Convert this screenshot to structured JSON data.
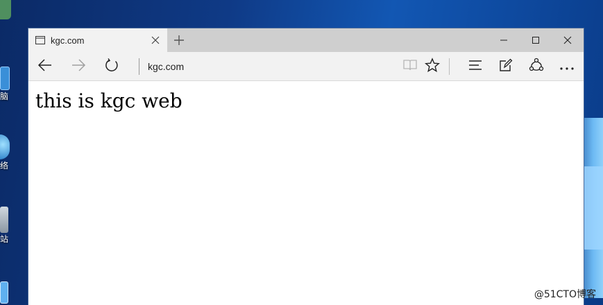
{
  "desktop": {
    "icons": [
      {
        "label": "",
        "name": "desktop-user-icon"
      },
      {
        "label": "脑",
        "name": "desktop-computer-icon"
      },
      {
        "label": "络",
        "name": "desktop-network-icon"
      },
      {
        "label": "站",
        "name": "desktop-recycle-bin-icon"
      },
      {
        "label": "",
        "name": "desktop-control-panel-icon"
      }
    ],
    "watermark": "@51CTO博客"
  },
  "browser": {
    "tab": {
      "title": "kgc.com"
    },
    "address": {
      "value": "kgc.com"
    },
    "icons": {
      "back": "back-arrow-icon",
      "forward": "forward-arrow-icon",
      "refresh": "refresh-icon",
      "reading_view": "reading-view-icon",
      "favorite": "star-icon",
      "hub": "hub-icon",
      "web_note": "web-note-icon",
      "share": "share-icon",
      "more": "more-icon"
    },
    "colors": {
      "tabstrip": "#cfcfcf",
      "toolbar": "#f2f2f2",
      "forward_disabled": "#a0a0a0"
    }
  },
  "page": {
    "body_text": "this is kgc web"
  }
}
